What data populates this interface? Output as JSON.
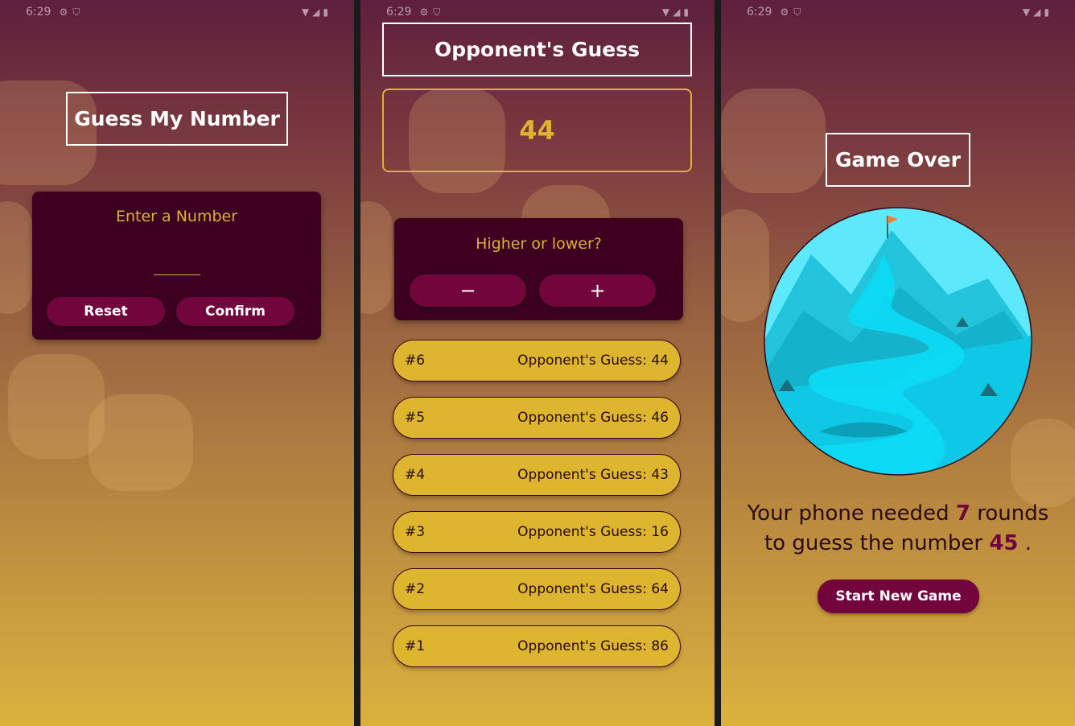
{
  "status_bar": {
    "time": "6:29"
  },
  "screen1": {
    "title": "Guess My Number",
    "input_label": "Enter a Number",
    "input_value": "",
    "reset_label": "Reset",
    "confirm_label": "Confirm"
  },
  "screen2": {
    "title": "Opponent's Guess",
    "current_guess": "44",
    "hint_label": "Higher or lower?",
    "minus_label": "−",
    "plus_label": "+",
    "log": [
      {
        "round": "#6",
        "text": "Opponent's Guess: 44"
      },
      {
        "round": "#5",
        "text": "Opponent's Guess: 46"
      },
      {
        "round": "#4",
        "text": "Opponent's Guess: 43"
      },
      {
        "round": "#3",
        "text": "Opponent's Guess: 16"
      },
      {
        "round": "#2",
        "text": "Opponent's Guess: 64"
      },
      {
        "round": "#1",
        "text": "Opponent's Guess: 86"
      }
    ]
  },
  "screen3": {
    "title": "Game Over",
    "summary_part1": "Your phone needed ",
    "rounds": "7",
    "summary_part2": " rounds to guess the number ",
    "number": "45",
    "summary_part3": " .",
    "new_game_label": "Start New Game"
  },
  "colors": {
    "primary": "#72063c",
    "card": "#3c0020",
    "accent": "#ddb52f",
    "gold_text": "#dcb03a"
  }
}
